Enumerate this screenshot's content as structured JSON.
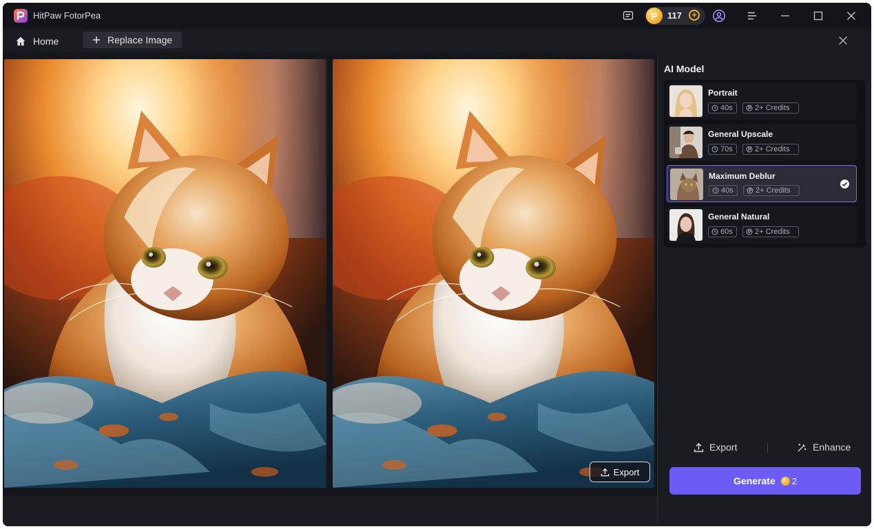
{
  "app": {
    "title": "HitPaw FotorPea"
  },
  "titlebar": {
    "credits": "117",
    "icons": [
      "tutorial-icon",
      "add-credits-icon",
      "account-icon",
      "menu-icon",
      "minimize-icon",
      "maximize-icon",
      "close-icon"
    ]
  },
  "tabs": {
    "home": "Home",
    "replace": "Replace Image"
  },
  "canvas": {
    "export_label": "Export"
  },
  "panel": {
    "title": "AI Model",
    "models": [
      {
        "name": "Portrait",
        "time": "40s",
        "credits": "2+ Credits",
        "selected": false
      },
      {
        "name": "General Upscale",
        "time": "70s",
        "credits": "2+ Credits",
        "selected": false
      },
      {
        "name": "Maximum Deblur",
        "time": "40s",
        "credits": "2+ Credits",
        "selected": true
      },
      {
        "name": "General Natural",
        "time": "60s",
        "credits": "2+ Credits",
        "selected": false
      }
    ],
    "export_label": "Export",
    "enhance_label": "Enhance",
    "generate_label": "Generate",
    "generate_cost": "2"
  },
  "colors": {
    "accent": "#6c5cf6",
    "background": "#1b1c22",
    "coin": "#f0a92a"
  }
}
